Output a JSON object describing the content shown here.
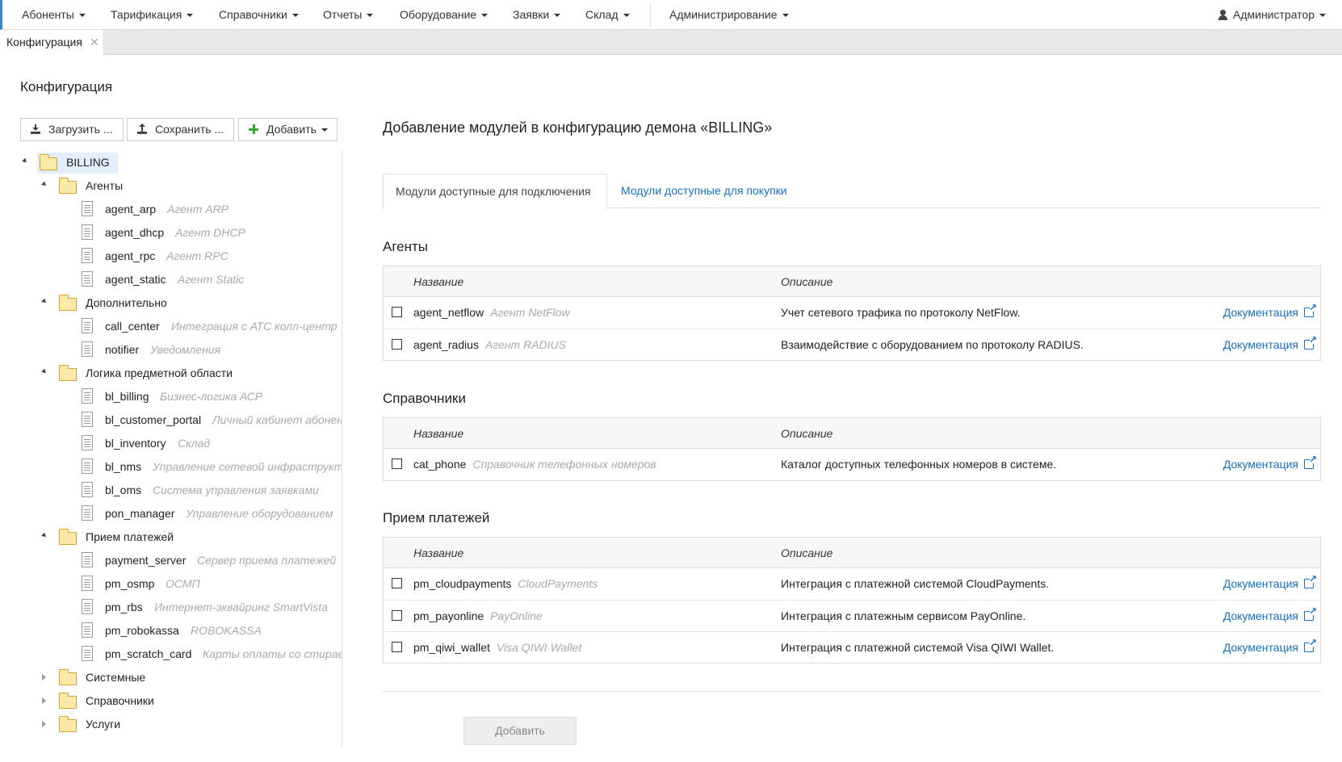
{
  "navbar": {
    "items": [
      "Абоненты",
      "Тарификация",
      "Справочники",
      "Отчеты",
      "Оборудование",
      "Заявки",
      "Склад",
      "Администрирование"
    ],
    "user": "Администратор"
  },
  "doc_tab": {
    "label": "Конфигурация",
    "close": "✕"
  },
  "page_title": "Конфигурация",
  "toolbar": {
    "load": "Загрузить ...",
    "save": "Сохранить ...",
    "add": "Добавить"
  },
  "tree": {
    "root": "BILLING",
    "groups": [
      {
        "label": "Агенты",
        "items": [
          {
            "name": "agent_arp",
            "desc": "Агент ARP"
          },
          {
            "name": "agent_dhcp",
            "desc": "Агент DHCP"
          },
          {
            "name": "agent_rpc",
            "desc": "Агент RPC"
          },
          {
            "name": "agent_static",
            "desc": "Агент Static"
          }
        ]
      },
      {
        "label": "Дополнительно",
        "items": [
          {
            "name": "call_center",
            "desc": "Интеграция с АТС колл-центр"
          },
          {
            "name": "notifier",
            "desc": "Уведомления"
          }
        ]
      },
      {
        "label": "Логика предметной области",
        "items": [
          {
            "name": "bl_billing",
            "desc": "Бизнес-логика АСР"
          },
          {
            "name": "bl_customer_portal",
            "desc": "Личный кабинет абонента"
          },
          {
            "name": "bl_inventory",
            "desc": "Склад"
          },
          {
            "name": "bl_nms",
            "desc": "Управление сетевой инфраструктурой"
          },
          {
            "name": "bl_oms",
            "desc": "Система управления заявками"
          },
          {
            "name": "pon_manager",
            "desc": "Управление оборудованием"
          }
        ]
      },
      {
        "label": "Прием платежей",
        "items": [
          {
            "name": "payment_server",
            "desc": "Сервер приема платежей"
          },
          {
            "name": "pm_osmp",
            "desc": "ОСМП"
          },
          {
            "name": "pm_rbs",
            "desc": "Интернет-эквайринг SmartVista"
          },
          {
            "name": "pm_robokassa",
            "desc": "ROBOKASSA"
          },
          {
            "name": "pm_scratch_card",
            "desc": "Карты оплаты со стираемым слоем"
          }
        ]
      }
    ],
    "collapsed": [
      "Системные",
      "Справочники",
      "Услуги"
    ]
  },
  "right": {
    "title": "Добавление модулей в конфигурацию демона «BILLING»",
    "tab_active": "Модули доступные для подключения",
    "tab_other": "Модули доступные для покупки",
    "col_name": "Название",
    "col_desc": "Описание",
    "doc_link": "Документация",
    "sections": [
      {
        "title": "Агенты",
        "rows": [
          {
            "name": "agent_netflow",
            "alias": "Агент NetFlow",
            "desc": "Учет сетевого трафика по протоколу NetFlow."
          },
          {
            "name": "agent_radius",
            "alias": "Агент RADIUS",
            "desc": "Взаимодействие с оборудованием по протоколу RADIUS."
          }
        ]
      },
      {
        "title": "Справочники",
        "rows": [
          {
            "name": "cat_phone",
            "alias": "Справочник телефонных номеров",
            "desc": "Каталог доступных телефонных номеров в системе."
          }
        ]
      },
      {
        "title": "Прием платежей",
        "rows": [
          {
            "name": "pm_cloudpayments",
            "alias": "CloudPayments",
            "desc": "Интеграция с платежной системой CloudPayments."
          },
          {
            "name": "pm_payonline",
            "alias": "PayOnline",
            "desc": "Интеграция с платежным сервисом PayOnline."
          },
          {
            "name": "pm_qiwi_wallet",
            "alias": "Visa QIWI Wallet",
            "desc": "Интеграция с платежной системой Visa QIWI Wallet."
          }
        ]
      }
    ],
    "add_button": "Добавить"
  }
}
